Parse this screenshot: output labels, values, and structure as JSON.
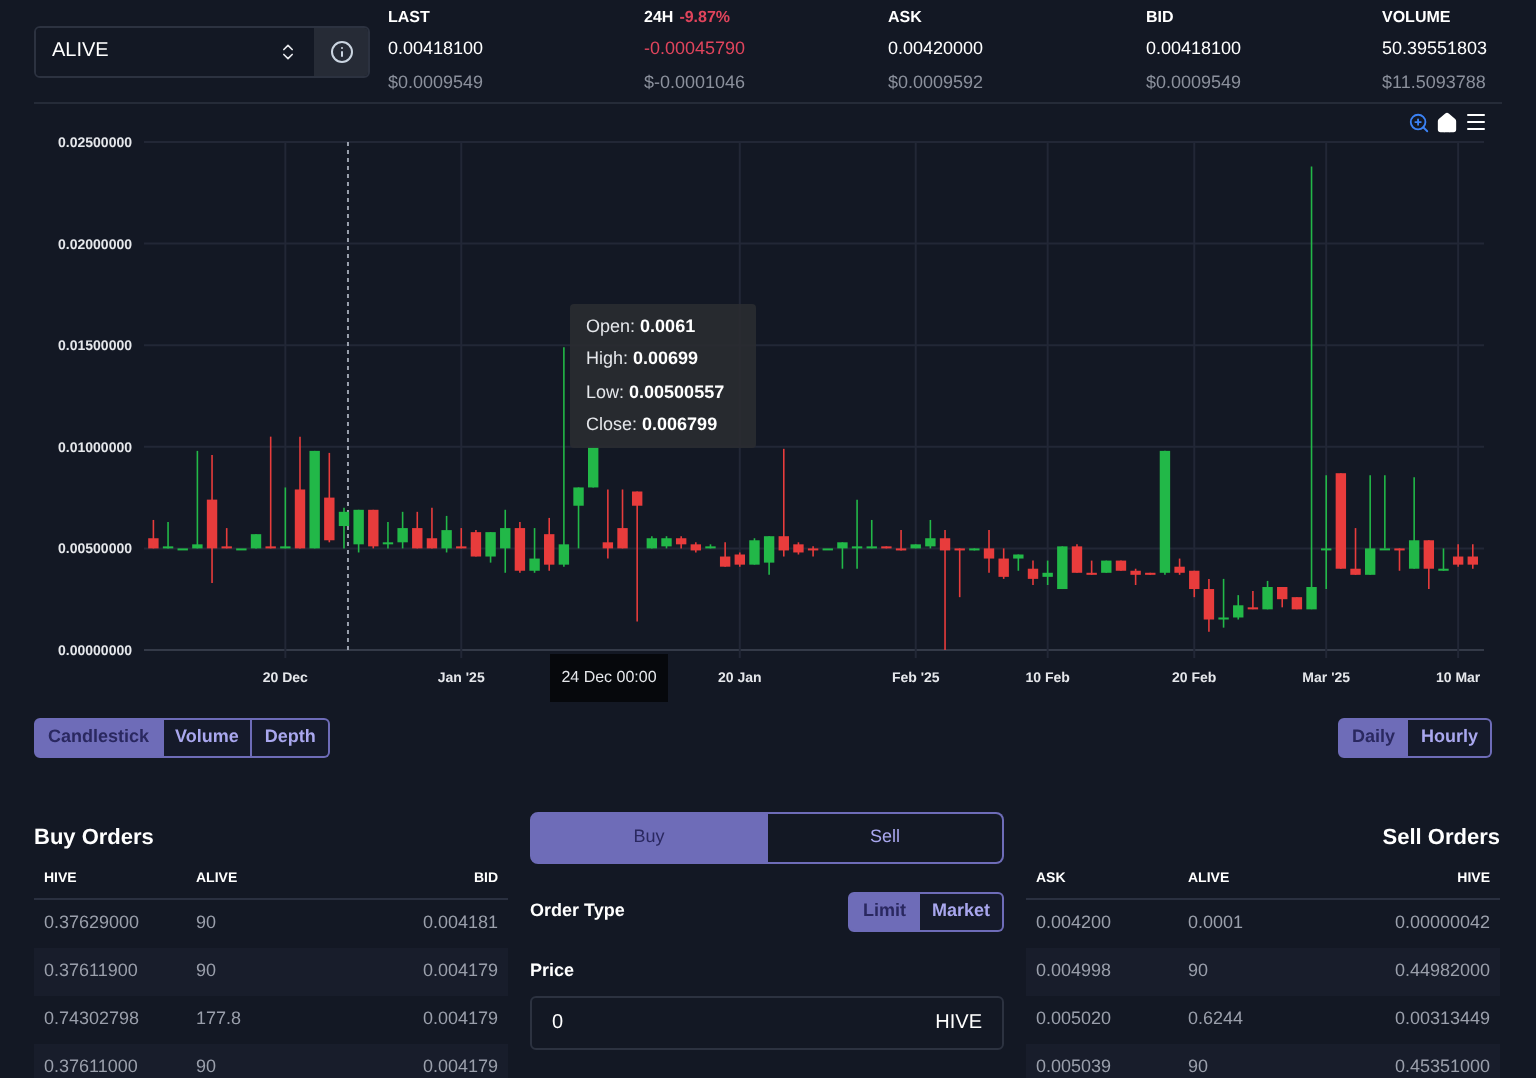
{
  "market_select": {
    "value": "ALIVE"
  },
  "stats": [
    {
      "label": "LAST",
      "value": "0.00418100",
      "usd": "$0.0009549",
      "color": "#ffffff"
    },
    {
      "label": "24H",
      "change": "-9.87%",
      "value": "-0.00045790",
      "usd": "$-0.0001046",
      "color": "#e0445c"
    },
    {
      "label": "ASK",
      "value": "0.00420000",
      "usd": "$0.0009592",
      "color": "#ffffff"
    },
    {
      "label": "BID",
      "value": "0.00418100",
      "usd": "$0.0009549",
      "color": "#ffffff"
    },
    {
      "label": "VOLUME",
      "value": "50.39551803",
      "usd": "$11.5093788",
      "color": "#ffffff"
    }
  ],
  "chart": {
    "chart_data": {
      "type": "candlestick",
      "ylim": [
        0,
        0.025
      ],
      "grid": true,
      "yticks": [
        {
          "value": 0,
          "label": "0.00000000"
        },
        {
          "value": 0.005,
          "label": "0.00500000"
        },
        {
          "value": 0.01,
          "label": "0.01000000"
        },
        {
          "value": 0.015,
          "label": "0.01500000"
        },
        {
          "value": 0.02,
          "label": "0.02000000"
        },
        {
          "value": 0.025,
          "label": "0.02500000"
        }
      ],
      "categories": [
        null,
        null,
        null,
        null,
        null,
        null,
        null,
        null,
        null,
        "20 Dec",
        null,
        null,
        null,
        null,
        null,
        null,
        null,
        null,
        null,
        null,
        null,
        "Jan '25",
        null,
        null,
        null,
        null,
        null,
        null,
        null,
        null,
        null,
        null,
        null,
        null,
        null,
        null,
        null,
        null,
        null,
        null,
        "20 Jan",
        null,
        null,
        null,
        null,
        null,
        null,
        null,
        null,
        null,
        null,
        null,
        "Feb '25",
        null,
        null,
        null,
        null,
        null,
        null,
        null,
        null,
        "10 Feb",
        null,
        null,
        null,
        null,
        null,
        null,
        null,
        null,
        null,
        "20 Feb",
        null,
        null,
        null,
        null,
        null,
        null,
        null,
        null,
        "Mar '25",
        null,
        null,
        null,
        null,
        null,
        null,
        null,
        null,
        "10 Mar",
        null
      ],
      "ohlc": [
        [
          0.0055,
          0.0064,
          0.005,
          0.005
        ],
        [
          0.005,
          0.0063,
          0.005,
          0.0051
        ],
        [
          0.005,
          0.005,
          0.005,
          0.005
        ],
        [
          0.005,
          0.0098,
          0.005,
          0.0052
        ],
        [
          0.0074,
          0.0096,
          0.0033,
          0.005
        ],
        [
          0.0051,
          0.006,
          0.005,
          0.005
        ],
        [
          0.005,
          0.005,
          0.005,
          0.005
        ],
        [
          0.005,
          0.0057,
          0.005,
          0.0057
        ],
        [
          0.0051,
          0.0105,
          0.005,
          0.005
        ],
        [
          0.005,
          0.008,
          0.005,
          0.0051
        ],
        [
          0.0079,
          0.0105,
          0.005,
          0.005
        ],
        [
          0.005,
          0.0098,
          0.005,
          0.0098
        ],
        [
          0.0075,
          0.0097,
          0.0053,
          0.0054
        ],
        [
          0.0061,
          0.007,
          0.005,
          0.0068
        ],
        [
          0.0052,
          0.0069,
          0.0048,
          0.0069
        ],
        [
          0.0069,
          0.0069,
          0.005,
          0.0051
        ],
        [
          0.0052,
          0.0063,
          0.005,
          0.0053
        ],
        [
          0.0053,
          0.0068,
          0.005,
          0.006
        ],
        [
          0.006,
          0.0068,
          0.005,
          0.005
        ],
        [
          0.0055,
          0.007,
          0.005,
          0.005
        ],
        [
          0.005,
          0.0066,
          0.0048,
          0.0059
        ],
        [
          0.0051,
          0.006,
          0.005,
          0.005
        ],
        [
          0.0058,
          0.0059,
          0.0046,
          0.0046
        ],
        [
          0.0046,
          0.0058,
          0.0043,
          0.0058
        ],
        [
          0.005,
          0.0069,
          0.0038,
          0.006
        ],
        [
          0.006,
          0.0063,
          0.0038,
          0.0039
        ],
        [
          0.0039,
          0.006,
          0.0038,
          0.0045
        ],
        [
          0.0057,
          0.0065,
          0.0039,
          0.0042
        ],
        [
          0.0042,
          0.0149,
          0.0041,
          0.0052
        ],
        [
          0.0071,
          0.008,
          0.005,
          0.008
        ],
        [
          0.008,
          0.01,
          0.008,
          0.01
        ],
        [
          0.0053,
          0.0079,
          0.0045,
          0.005
        ],
        [
          0.006,
          0.0079,
          0.005,
          0.005
        ],
        [
          0.0078,
          0.0078,
          0.0014,
          0.0071
        ],
        [
          0.005,
          0.0056,
          0.005,
          0.0055
        ],
        [
          0.0051,
          0.0056,
          0.005,
          0.0055
        ],
        [
          0.0055,
          0.0056,
          0.005,
          0.0052
        ],
        [
          0.0052,
          0.0053,
          0.0048,
          0.0049
        ],
        [
          0.005,
          0.0052,
          0.005,
          0.0051
        ],
        [
          0.0046,
          0.0053,
          0.0041,
          0.0041
        ],
        [
          0.0047,
          0.0048,
          0.0041,
          0.0042
        ],
        [
          0.0042,
          0.0055,
          0.0042,
          0.0054
        ],
        [
          0.0043,
          0.0056,
          0.0037,
          0.0056
        ],
        [
          0.0056,
          0.0099,
          0.0046,
          0.0049
        ],
        [
          0.0052,
          0.0053,
          0.0047,
          0.0048
        ],
        [
          0.005,
          0.0051,
          0.0046,
          0.0049
        ],
        [
          0.005,
          0.005,
          0.005,
          0.005
        ],
        [
          0.005,
          0.0053,
          0.004,
          0.0053
        ],
        [
          0.005,
          0.0074,
          0.004,
          0.0051
        ],
        [
          0.005,
          0.0064,
          0.005,
          0.0051
        ],
        [
          0.0051,
          0.0051,
          0.005,
          0.005
        ],
        [
          0.005,
          0.0059,
          0.0049,
          0.0049
        ],
        [
          0.005,
          0.0052,
          0.005,
          0.0052
        ],
        [
          0.0051,
          0.0064,
          0.005,
          0.0055
        ],
        [
          0.0055,
          0.0059,
          0,
          0.0049
        ],
        [
          0.005,
          0.005,
          0.0026,
          0.0049
        ],
        [
          0.0049,
          0.005,
          0.0049,
          0.005
        ],
        [
          0.005,
          0.0059,
          0.0038,
          0.0045
        ],
        [
          0.0045,
          0.005,
          0.0035,
          0.0036
        ],
        [
          0.0045,
          0.0047,
          0.0039,
          0.0047
        ],
        [
          0.004,
          0.0044,
          0.0032,
          0.0035
        ],
        [
          0.0036,
          0.0044,
          0.0032,
          0.0038
        ],
        [
          0.003,
          0.0051,
          0.003,
          0.0051
        ],
        [
          0.0051,
          0.0052,
          0.0038,
          0.0038
        ],
        [
          0.0038,
          0.0044,
          0.0037,
          0.0037
        ],
        [
          0.0038,
          0.0044,
          0.0038,
          0.0044
        ],
        [
          0.0044,
          0.0044,
          0.0039,
          0.0039
        ],
        [
          0.0039,
          0.004,
          0.0032,
          0.0037
        ],
        [
          0.0038,
          0.0038,
          0.0037,
          0.0037
        ],
        [
          0.0038,
          0.0098,
          0.0037,
          0.0098
        ],
        [
          0.0041,
          0.0045,
          0.0037,
          0.0038
        ],
        [
          0.0039,
          0.0039,
          0.0026,
          0.003
        ],
        [
          0.003,
          0.0035,
          0.0009,
          0.0015
        ],
        [
          0.0015,
          0.0035,
          0.0011,
          0.0016
        ],
        [
          0.0016,
          0.0027,
          0.0015,
          0.0022
        ],
        [
          0.0021,
          0.0029,
          0.002,
          0.002
        ],
        [
          0.002,
          0.0034,
          0.002,
          0.0031
        ],
        [
          0.0031,
          0.0031,
          0.0021,
          0.0025
        ],
        [
          0.0026,
          0.0026,
          0.002,
          0.002
        ],
        [
          0.002,
          0.0238,
          0.002,
          0.0031
        ],
        [
          0.005,
          0.0086,
          0.003,
          0.005
        ],
        [
          0.0087,
          0.0087,
          0.004,
          0.004
        ],
        [
          0.004,
          0.006,
          0.0037,
          0.0037
        ],
        [
          0.0037,
          0.0086,
          0.0037,
          0.005
        ],
        [
          0.005,
          0.0086,
          0.005,
          0.005
        ],
        [
          0.005,
          0.005,
          0.0039,
          0.0049
        ],
        [
          0.004,
          0.0085,
          0.004,
          0.0054
        ],
        [
          0.0054,
          0.0054,
          0.003,
          0.004
        ],
        [
          0.0039,
          0.005,
          0.0039,
          0.004
        ],
        [
          0.0046,
          0.0052,
          0.0041,
          0.0042
        ],
        [
          0.0046,
          0.0052,
          0.004,
          0.0042
        ]
      ]
    },
    "tooltip": {
      "rows": [
        {
          "label": "Open:",
          "value": "0.0061"
        },
        {
          "label": "High:",
          "value": "0.00699"
        },
        {
          "label": "Low:",
          "value": "0.00500557"
        },
        {
          "label": "Close:",
          "value": "0.006799"
        }
      ]
    },
    "crosshair_label": "24 Dec 00:00"
  },
  "chart_types": [
    {
      "label": "Candlestick",
      "selected": true
    },
    {
      "label": "Volume",
      "selected": false
    },
    {
      "label": "Depth",
      "selected": false
    }
  ],
  "intervals": [
    {
      "label": "Daily",
      "selected": true
    },
    {
      "label": "Hourly",
      "selected": false
    }
  ],
  "buy_orders": {
    "title": "Buy Orders",
    "columns": [
      "HIVE",
      "ALIVE",
      "BID"
    ],
    "rows": [
      [
        "0.37629000",
        "90",
        "0.004181"
      ],
      [
        "0.37611900",
        "90",
        "0.004179"
      ],
      [
        "0.74302798",
        "177.8",
        "0.004179"
      ],
      [
        "0.37611000",
        "90",
        "0.004179"
      ]
    ]
  },
  "order_form": {
    "sides": [
      {
        "label": "Buy",
        "selected": true
      },
      {
        "label": "Sell",
        "selected": false
      }
    ],
    "order_type_label": "Order Type",
    "order_types": [
      {
        "label": "Limit",
        "selected": true
      },
      {
        "label": "Market",
        "selected": false
      }
    ],
    "price_label": "Price",
    "price_value": "0",
    "price_unit": "HIVE"
  },
  "sell_orders": {
    "title": "Sell Orders",
    "columns": [
      "ASK",
      "ALIVE",
      "HIVE"
    ],
    "rows": [
      [
        "0.004200",
        "0.0001",
        "0.00000042"
      ],
      [
        "0.004998",
        "90",
        "0.44982000"
      ],
      [
        "0.005020",
        "0.6244",
        "0.00313449"
      ],
      [
        "0.005039",
        "90",
        "0.45351000"
      ]
    ]
  }
}
